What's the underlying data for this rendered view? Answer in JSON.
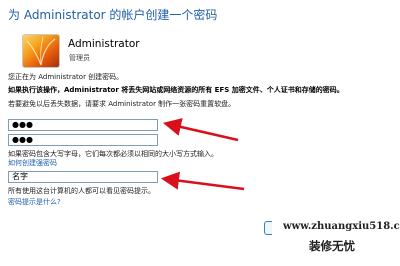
{
  "window": {
    "title": "为 Administrator 的帐户创建一个密码"
  },
  "user": {
    "name": "Administrator",
    "role": "管理员"
  },
  "body": {
    "intro": "您正在为 Administrator 创建密码。",
    "warning": "如果执行该操作，Administrator 将丢失网站或网络资源的所有 EFS 加密文件、个人证书和存储的密码。",
    "advice": "若要避免以后丢失数据，请要求 Administrator 制作一张密码重置软盘。"
  },
  "form": {
    "new_password_value": "●●●",
    "confirm_password_value": "●●●",
    "case_note": "如果密码包含大写字母，它们每次都必须以相同的大小写方式输入。",
    "strong_password_link": "如何创建强密码",
    "hint_value": "名字",
    "hint_note": "所有使用这台计算机的人都可以看见密码提示。",
    "what_is_hint_link": "密码提示是什么?"
  },
  "watermark": {
    "url": "www.zhuangxiu518.com",
    "text": "装修无忧"
  },
  "colors": {
    "title": "#1f5fa8",
    "link": "#1e5fb0",
    "arrow": "#d9101c",
    "field_border": "#7f9db9"
  }
}
